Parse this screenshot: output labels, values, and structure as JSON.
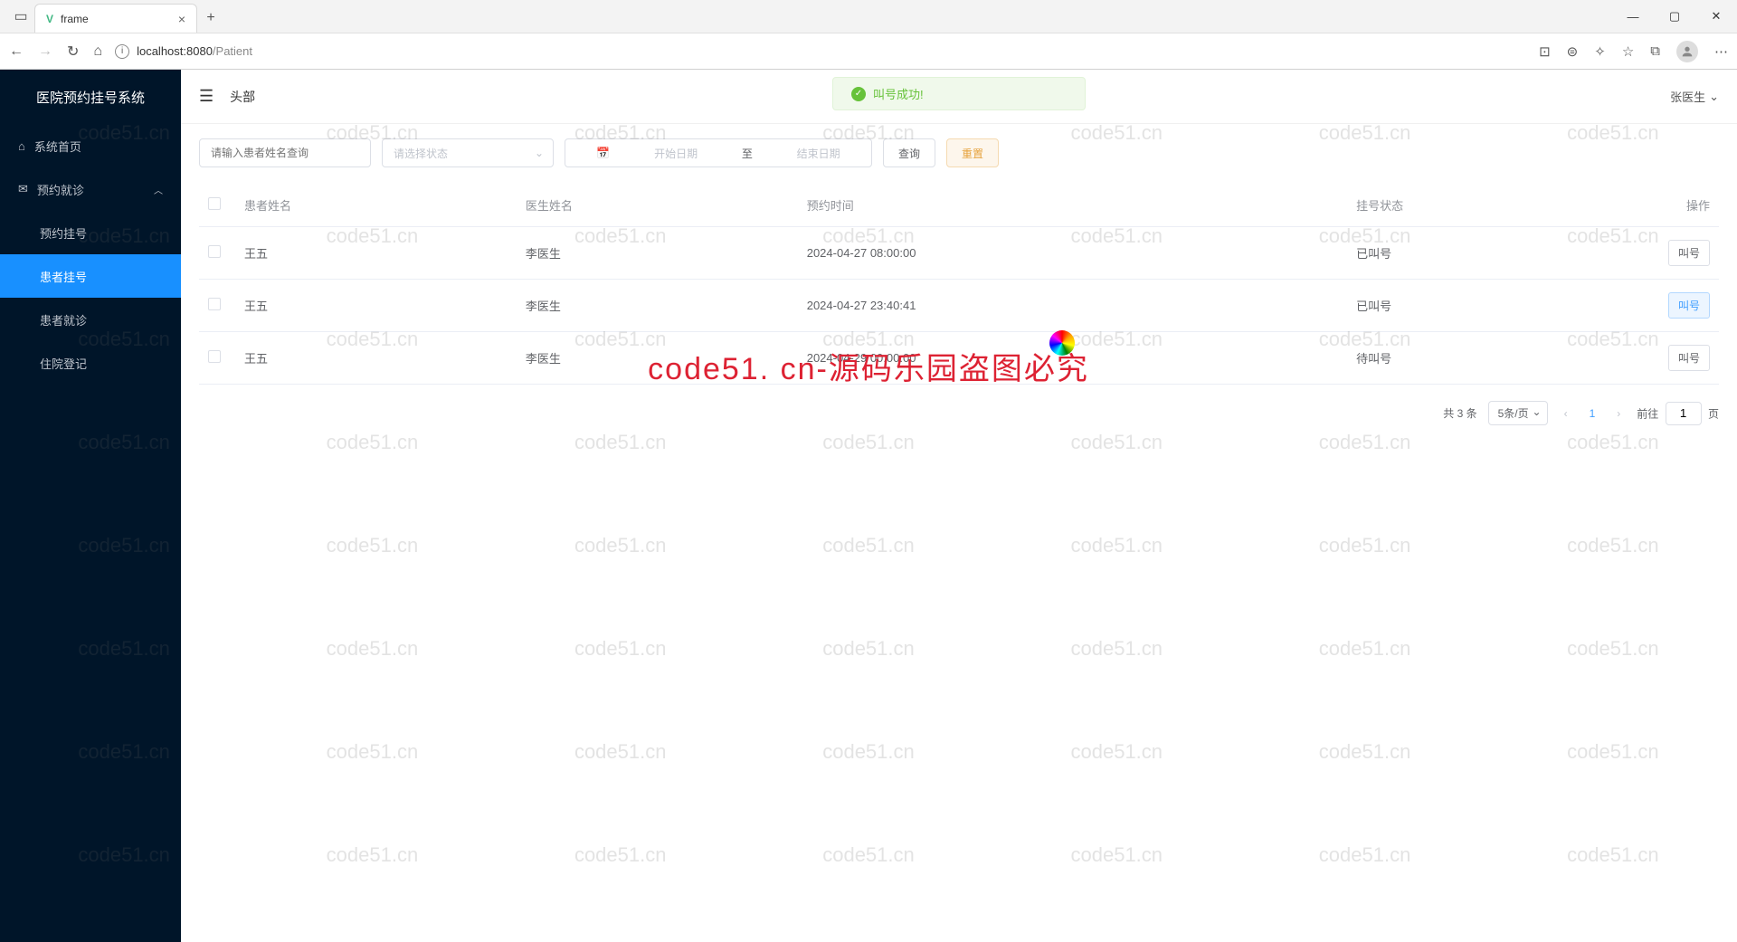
{
  "browser": {
    "tab_title": "frame",
    "url_host": "localhost:",
    "url_port": "8080",
    "url_path": "/Patient"
  },
  "sidebar": {
    "logo": "医院预约挂号系统",
    "items": [
      {
        "icon": "⌂",
        "label": "系统首页"
      },
      {
        "icon": "✉",
        "label": "预约就诊",
        "expandable": true
      }
    ],
    "sub_items": [
      {
        "label": "预约挂号"
      },
      {
        "label": "患者挂号",
        "active": true
      },
      {
        "label": "患者就诊"
      },
      {
        "label": "住院登记"
      }
    ]
  },
  "header": {
    "title": "头部",
    "user": "张医生"
  },
  "toast": "叫号成功!",
  "filters": {
    "name_placeholder": "请输入患者姓名查询",
    "status_placeholder": "请选择状态",
    "date_start_placeholder": "开始日期",
    "date_sep": "至",
    "date_end_placeholder": "结束日期",
    "search_btn": "查询",
    "reset_btn": "重置"
  },
  "table": {
    "columns": [
      "患者姓名",
      "医生姓名",
      "预约时间",
      "挂号状态",
      "操作"
    ],
    "rows": [
      {
        "patient": "王五",
        "doctor": "李医生",
        "time": "2024-04-27 08:00:00",
        "status": "已叫号",
        "status_cls": "status-called",
        "btn": "叫号",
        "btn_cls": "mini-btn"
      },
      {
        "patient": "王五",
        "doctor": "李医生",
        "time": "2024-04-27 23:40:41",
        "status": "已叫号",
        "status_cls": "status-called",
        "btn": "叫号",
        "btn_cls": "mini-btn primary-plain"
      },
      {
        "patient": "王五",
        "doctor": "李医生",
        "time": "2024-04-29 00:00:00",
        "status": "待叫号",
        "status_cls": "status-wait",
        "btn": "叫号",
        "btn_cls": "mini-btn"
      }
    ]
  },
  "pagination": {
    "total": "共 3 条",
    "page_size": "5条/页",
    "current": "1",
    "goto_pre": "前往",
    "goto_val": "1",
    "goto_suf": "页"
  },
  "watermark_text": "code51.cn",
  "big_watermark": "code51. cn-源码乐园盗图必究"
}
